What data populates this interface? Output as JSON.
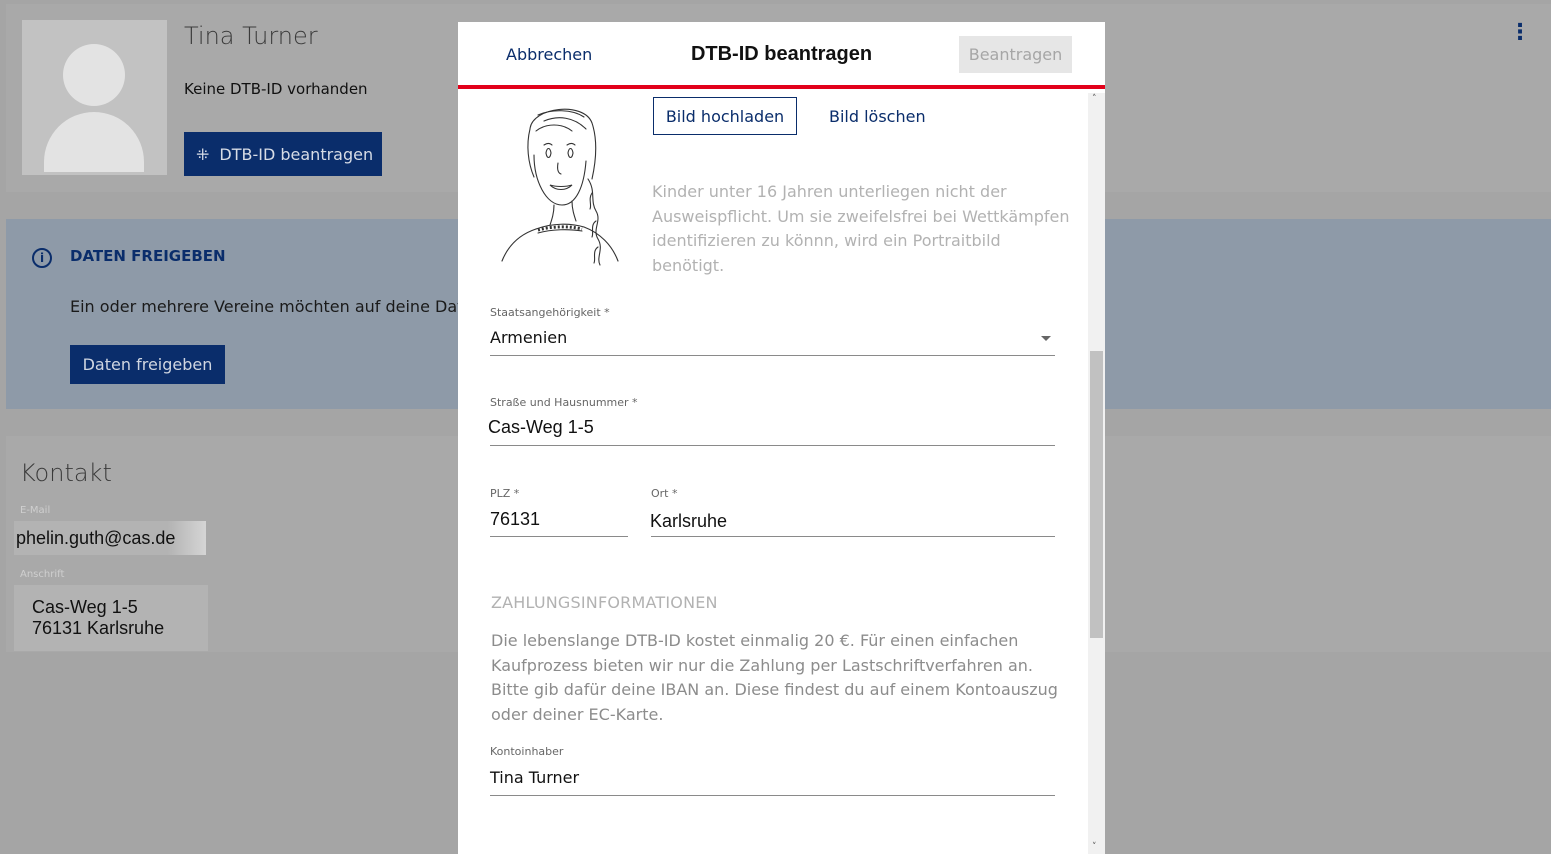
{
  "profile": {
    "name": "Tina Turner",
    "status": "Keine DTB-ID vorhanden",
    "apply_button_label": "DTB-ID beantragen",
    "apply_button_icon": "id-card-icon",
    "menu_icon": "kebab-menu-icon"
  },
  "share": {
    "icon": "info-icon",
    "title": "DATEN FREIGEBEN",
    "text": "Ein oder mehrere Vereine möchten auf deine Daten",
    "button_label": "Daten freigeben"
  },
  "contact": {
    "title": "Kontakt",
    "email_label": "E-Mail",
    "email": "phelin.guth@cas.de",
    "address_label": "Anschrift",
    "address_line1": "Cas-Weg 1-5",
    "address_line2": "76131 Karlsruhe"
  },
  "modal": {
    "cancel_label": "Abbrechen",
    "title": "DTB-ID beantragen",
    "submit_label": "Beantragen",
    "accent_color": "#e2001a",
    "upload_label": "Bild hochladen",
    "delete_label": "Bild löschen",
    "hint": "Kinder unter 16 Jahren unterliegen nicht der Ausweispflicht. Um sie zweifelsfrei bei Wettkämpfen identifizieren zu könnn, wird ein Portraitbild benötigt.",
    "nationality_label": "Staatsangehörigkeit *",
    "nationality_value": "Armenien",
    "street_label": "Straße und Hausnummer *",
    "street_value": "Cas-Weg 1-5",
    "zip_label": "PLZ *",
    "zip_value": "76131",
    "city_label": "Ort *",
    "city_value": "Karlsruhe",
    "payment_title": "ZAHLUNGSINFORMATIONEN",
    "payment_text": "Die lebenslange DTB-ID kostet einmalig 20 €. Für einen einfachen Kaufprozess bieten wir nur die Zahlung per Lastschriftverfahren an. Bitte gib dafür deine IBAN an. Diese findest du auf einem Kontoauszug oder deiner EC-Karte.",
    "account_holder_label": "Kontoinhaber",
    "account_holder_value": "Tina Turner"
  },
  "colors": {
    "brand": "#0a2d6b",
    "accent": "#e2001a"
  }
}
